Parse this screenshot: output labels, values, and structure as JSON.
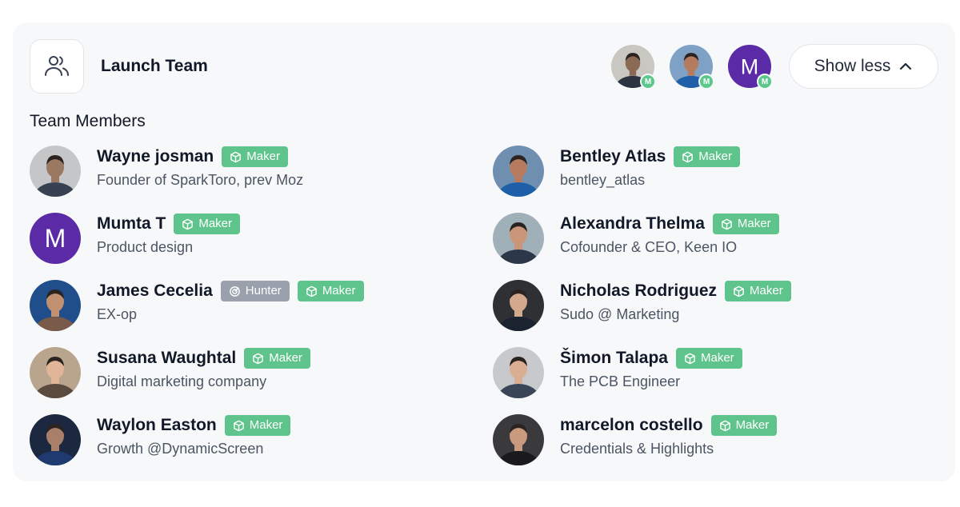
{
  "header": {
    "title": "Launch Team",
    "show_less_label": "Show less",
    "avatar_badge_letter": "M",
    "avatars": [
      {
        "kind": "photo",
        "skin": "#8a6a55",
        "bg": "#c9c7c2",
        "shirt": "#2b3440"
      },
      {
        "kind": "photo",
        "skin": "#b57b5e",
        "bg": "#7fa1c6",
        "shirt": "#1f5fa8"
      },
      {
        "kind": "letter",
        "letter": "M",
        "bg": "#5b2aa6"
      }
    ]
  },
  "section_title": "Team Members",
  "members": [
    {
      "name": "Wayne josman",
      "role": "Founder of SparkToro, prev Moz",
      "tags": [
        "Maker"
      ],
      "avatar": {
        "kind": "photo",
        "bg": "#c4c6c8",
        "skin": "#9a7862",
        "shirt": "#374151"
      }
    },
    {
      "name": "Mumta T",
      "role": "Product design",
      "tags": [
        "Maker"
      ],
      "avatar": {
        "kind": "letter",
        "letter": "M",
        "bg": "#5b2aa6"
      }
    },
    {
      "name": "James Cecelia",
      "role": "EX-op",
      "tags": [
        "Hunter",
        "Maker"
      ],
      "avatar": {
        "kind": "photo",
        "bg": "#1f4e8a",
        "skin": "#c09070",
        "shirt": "#7a5b4a"
      }
    },
    {
      "name": "Susana Waughtal",
      "role": "Digital marketing company",
      "tags": [
        "Maker"
      ],
      "avatar": {
        "kind": "photo",
        "bg": "#b9a48e",
        "skin": "#e0b598",
        "shirt": "#5b4a3e"
      }
    },
    {
      "name": "Waylon Easton",
      "role": "Growth @DynamicScreen",
      "tags": [
        "Maker"
      ],
      "avatar": {
        "kind": "photo",
        "bg": "#1c2740",
        "skin": "#a8806a",
        "shirt": "#1e3a6e"
      }
    },
    {
      "name": "Bentley Atlas",
      "role": "bentley_atlas",
      "tags": [
        "Maker"
      ],
      "avatar": {
        "kind": "photo",
        "bg": "#6f8fb0",
        "skin": "#b57b5e",
        "shirt": "#1f5fa8"
      }
    },
    {
      "name": "Alexandra Thelma",
      "role": "Cofounder & CEO, Keen IO",
      "tags": [
        "Maker"
      ],
      "avatar": {
        "kind": "photo",
        "bg": "#9fb0b8",
        "skin": "#c9967a",
        "shirt": "#2c3747"
      }
    },
    {
      "name": "Nicholas Rodriguez",
      "role": "Sudo @ Marketing",
      "tags": [
        "Maker"
      ],
      "avatar": {
        "kind": "photo",
        "bg": "#2f3033",
        "skin": "#d4a88c",
        "shirt": "#1b2230"
      }
    },
    {
      "name": "Šimon Talapa",
      "role": "The PCB Engineer",
      "tags": [
        "Maker"
      ],
      "avatar": {
        "kind": "photo",
        "bg": "#c7c9cc",
        "skin": "#d9ae92",
        "shirt": "#3a4658"
      }
    },
    {
      "name": "marcelon costello",
      "role": "Credentials & Highlights",
      "tags": [
        "Maker"
      ],
      "avatar": {
        "kind": "photo",
        "bg": "#3a3a3c",
        "skin": "#c99a7e",
        "shirt": "#1a1a1c"
      }
    }
  ],
  "colors": {
    "maker": "#5fc48b",
    "hunter": "#9aa1ac",
    "card_bg": "#f7f8fa"
  },
  "icons": {
    "team": "users-icon",
    "chevron": "chevron-up-icon",
    "maker": "cube-icon",
    "hunter": "target-icon"
  }
}
